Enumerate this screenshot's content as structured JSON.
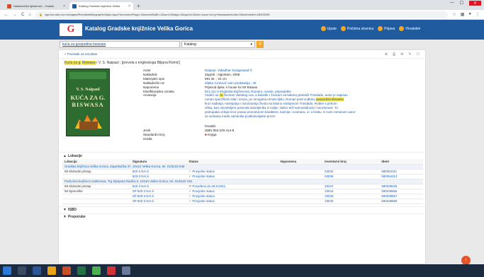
{
  "browser": {
    "tabs": [
      {
        "title": "Nakladnička djelatnost – Gradsk",
        "active": false
      },
      {
        "title": "Katalog Gradske knjižnice Velika",
        "active": true
      }
    ],
    "url": "vgorica.zaki.com.hr/pages/Results/bibliographicZapis.aspx?documentPage=1&searchByBr=1&sort=0&tage=0&spoId=0&chr=kuca+za+g+biswasa&modId=0&selectedId=28400395"
  },
  "site": {
    "title": "Katalog Gradske knjižnice Velika Gorica",
    "nav": [
      "Upute",
      "Početna stranica",
      "Prijava",
      "Hrvatski"
    ]
  },
  "search": {
    "query": "kuća za gospodina biswasa",
    "scope": "Katalog"
  },
  "record": {
    "back_label": "Povratak na rezultate",
    "title_hl1": "Kuća za g.",
    "title_hl2": "Biswasa",
    "title_rest": "/ V. S. Naipaul ; [prevela s engleskoga Biljana Romić]",
    "cover": {
      "author": "V. S. Naipaul",
      "title_line1": "KUĆA ZA G.",
      "title_line2": "BISWASA"
    },
    "labels": {
      "autor": "Autor",
      "nakladnik": "Nakladnik",
      "opis": "Materijalni opis",
      "niz": "Nakladnički niz",
      "napomena": "Napomena",
      "klasifikacija": "Klasifikacijska oznaka",
      "anotacija": "Anotacija",
      "jezik": "Jezik",
      "isbn": "Standardni broj",
      "grada": "Građa"
    },
    "values": {
      "autor": "Naipaul, Vidiadhar Surajprasad",
      "nakladnik": "Zagreb : Algoritam, 2006",
      "opis": "591 str. ; 24 cm",
      "niz": "Zlatko Crnković sam predstavlja ; 46",
      "napomena": "Prijevod djela: A house for Mr Biswas.",
      "klasifikacija": "821.111-3 Engleska književnost. Romani, novele, pripovijetke",
      "anotacija_1": "Vodeći se",
      "anotacija_hl": "za",
      "anotacija_2": "životom vlastitog oca, a također i životom na bakinoj plantaži Trinidadu, autor je napisao",
      "anotacija_3": "roman specifičnih stila i izraza, po mnogima remek-djelo. Roman prati sudbinu",
      "anotacija_hl2": "gospodina Biswasa",
      "anotacija_4": "kroz nadanja, nastojanja i razočaranja životu na klasno raslojenom Trinidadu. Rođen s prstom",
      "anotacija_5": "viška, kao otvoriteljem potomak doseljenika iz Indije, stalno teži samostalnosti i neovisnosti. To",
      "anotacija_6": "postupaka očituje kroz posao promotorom karaktere, kasnije i novinara, a i u braku. S svim romanom autor",
      "anotacija_7": "se svrstava među začetnike postkolonijalne proze.",
      "jezik": "hrvatski",
      "isbn": "ISBN 953-220-414-8",
      "grada": "Knjiga"
    }
  },
  "sections": {
    "lokacije": "Lokacije",
    "isbd": "ISBD",
    "preporuke": "Preporuke"
  },
  "holdings": {
    "headers": [
      "Lokacija",
      "Signatura",
      "Status",
      "Napomena",
      "Inventarni broj",
      "Ident"
    ],
    "libraries": [
      {
        "name": "Gradska knjižnica Velika Gorica, Zagrebačka 37, 10410 Velika Gorica, tel. 01/6222-948",
        "rows": [
          {
            "loc": "58 Slobodni pristup",
            "sig": "820-3 NAI k",
            "status": "Provjerite status",
            "ok": true,
            "note": "",
            "inv": "63034",
            "ident": "580054311"
          },
          {
            "loc": "",
            "sig": "820-3 NAI k",
            "status": "Provjerite status",
            "ok": true,
            "note": "",
            "inv": "63036",
            "ident": "580054313"
          }
        ]
      },
      {
        "name": "Područna knjižnica Gašteraca, Trg Stjepana Radića 5, 10410 Velika Gorica, tel. 01/6222-194",
        "rows": [
          {
            "loc": "59 Slobodni pristup",
            "sig": "820-3 NAI k",
            "status": "Posuđeno do 29.5.2021.",
            "ok": false,
            "note": "",
            "inv": "33347",
            "ident": "590039226"
          },
          {
            "loc": "59 Spremište",
            "sig": "SP 820-3 NAI k",
            "status": "Provjerite status",
            "ok": true,
            "note": "",
            "inv": "33044",
            "ident": "590038866"
          },
          {
            "loc": "",
            "sig": "SP 820-3 NAI k",
            "status": "Provjerite status",
            "ok": true,
            "note": "",
            "inv": "33045",
            "ident": "590038867"
          },
          {
            "loc": "",
            "sig": "SP 820-3 NAI k",
            "status": "Provjerite status",
            "ok": true,
            "note": "",
            "inv": "33046",
            "ident": "590038868"
          }
        ]
      }
    ]
  },
  "colors": {
    "header": "#1f5b9e",
    "accent": "#f5a623",
    "link": "#1a5fb4",
    "highlight": "#f9e34b"
  }
}
